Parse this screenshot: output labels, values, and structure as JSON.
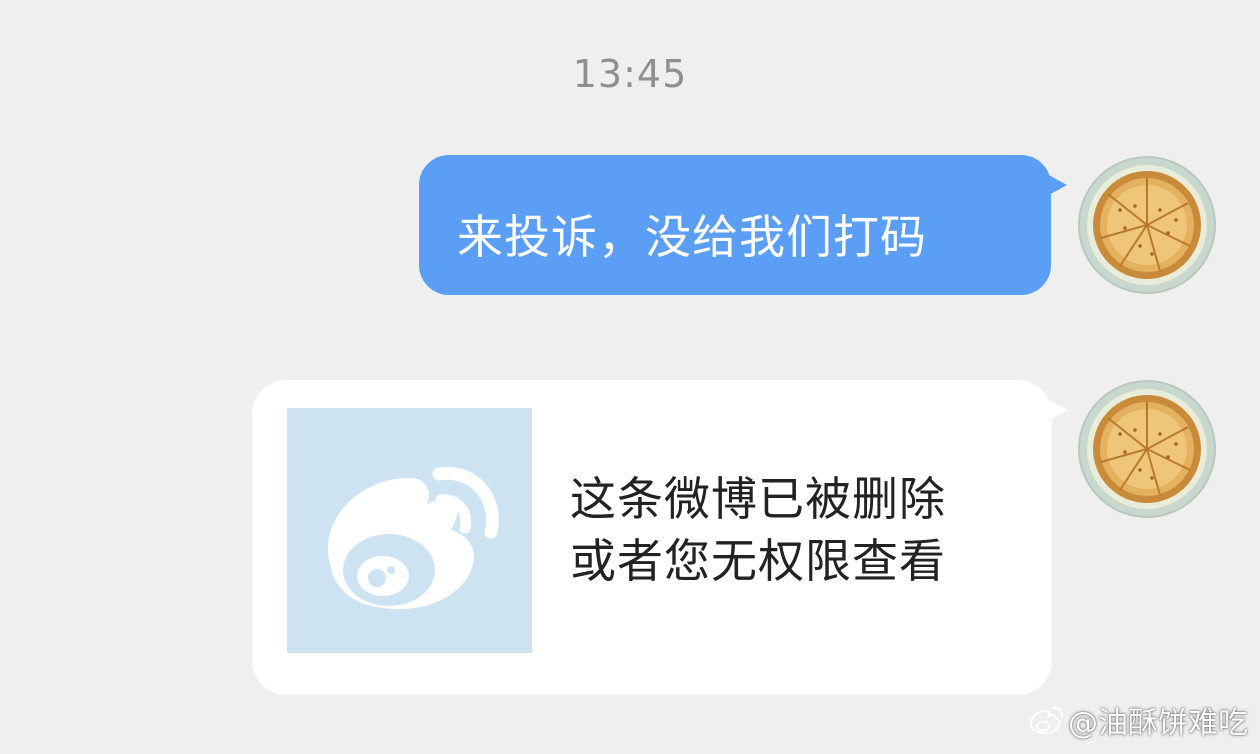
{
  "chat": {
    "timestamp": "13:45",
    "messages": [
      {
        "type": "text",
        "sender": "self",
        "text": "来投诉，没给我们打码"
      },
      {
        "type": "card",
        "sender": "self",
        "line1": "这条微博已被删除",
        "line2": "或者您无权限查看",
        "thumbnail_icon": "weibo-logo-icon"
      }
    ]
  },
  "watermark": {
    "text": "@油酥饼难吃",
    "icon": "weibo-logo-icon"
  },
  "colors": {
    "background": "#efefef",
    "self_bubble": "#5b9ef5",
    "card_bubble": "#ffffff",
    "thumbnail_bg": "#cde3f2"
  }
}
